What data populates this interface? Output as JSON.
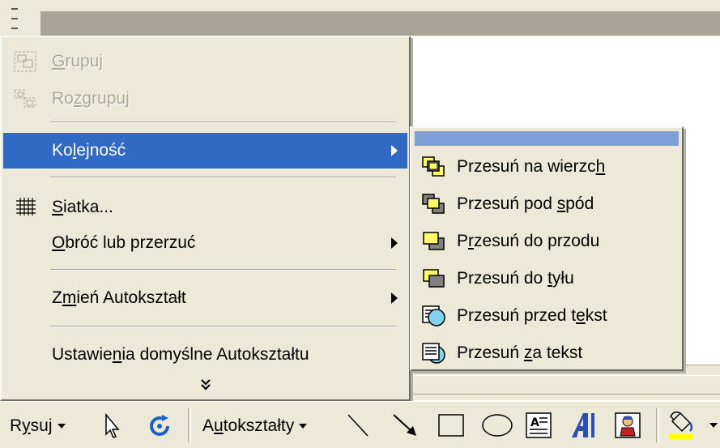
{
  "main_menu": {
    "items": [
      {
        "label_html": "<u>G</u>rupuj",
        "disabled": true
      },
      {
        "label_html": "Ro<u>z</u>grupuj",
        "disabled": true
      },
      {
        "label_html": "Ko<u>l</u>ejność",
        "highlighted": true
      },
      {
        "label_html": "<u>S</u>iatka..."
      },
      {
        "label_html": "<u>O</u>bróć lub przerzuć"
      },
      {
        "label_html": "Z<u>m</u>ień Autokształt"
      },
      {
        "label_html": "Ustawie<u>n</u>ia domyślne Autokształtu"
      }
    ],
    "more_glyph": "»"
  },
  "sub_menu": {
    "items": [
      {
        "label_html": "Przesuń na wierzc<u>h</u>"
      },
      {
        "label_html": "Przesuń pod <u>s</u>pód"
      },
      {
        "label_html": "P<u>r</u>zesuń do przodu"
      },
      {
        "label_html": "Przesuń do <u>t</u>yłu"
      },
      {
        "label_html": "Przesuń przed t<u>e</u>kst"
      },
      {
        "label_html": "Przesuń <u>z</u>a tekst"
      }
    ]
  },
  "toolbar": {
    "draw_html": "R<u>y</u>suj",
    "autoshapes_html": "A<u>u</u>tokształty"
  },
  "colors": {
    "menu_bg": "#ece9d8",
    "highlight": "#316ac5",
    "submenu_bar": "#7e9fd7",
    "fill_color": "#ffff00"
  }
}
